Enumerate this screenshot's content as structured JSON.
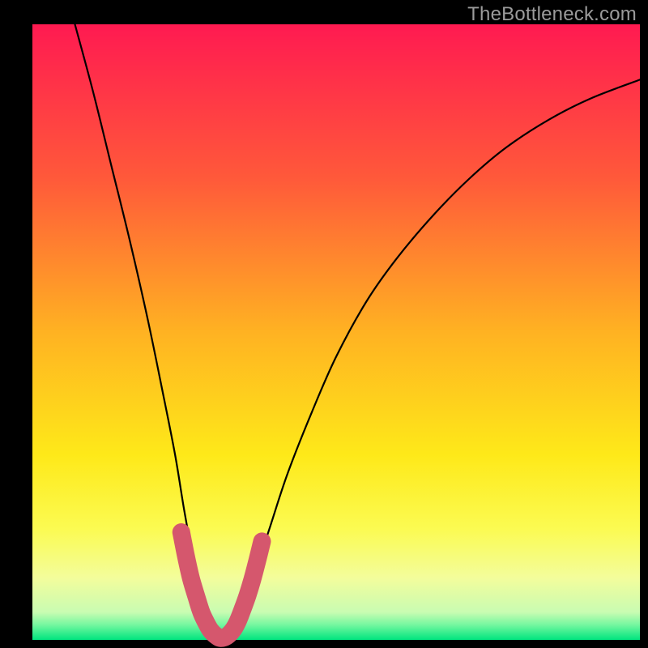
{
  "watermark": "TheBottleneck.com",
  "chart_data": {
    "type": "line",
    "title": "",
    "xlabel": "",
    "ylabel": "",
    "xlim": [
      0,
      100
    ],
    "ylim": [
      0,
      100
    ],
    "axes_visible": false,
    "background_gradient": {
      "stops": [
        {
          "pos": 0.0,
          "color": "#ff1a51"
        },
        {
          "pos": 0.25,
          "color": "#ff593a"
        },
        {
          "pos": 0.5,
          "color": "#ffb222"
        },
        {
          "pos": 0.7,
          "color": "#fee919"
        },
        {
          "pos": 0.82,
          "color": "#fbfb52"
        },
        {
          "pos": 0.9,
          "color": "#f3fd9c"
        },
        {
          "pos": 0.955,
          "color": "#c9fcb2"
        },
        {
          "pos": 0.975,
          "color": "#77f7a0"
        },
        {
          "pos": 1.0,
          "color": "#00e57f"
        }
      ]
    },
    "curve": {
      "x": [
        7,
        10,
        13,
        16,
        19,
        21.5,
        23.5,
        25,
        26.5,
        28,
        29.5,
        31,
        32.5,
        34,
        36,
        39,
        42,
        46,
        50,
        55,
        60,
        66,
        72,
        78,
        85,
        92,
        100
      ],
      "y": [
        100,
        89,
        77,
        65,
        52,
        40,
        30,
        21,
        13,
        6,
        1.5,
        0,
        1.2,
        4,
        9,
        18,
        27,
        37,
        46,
        55,
        62,
        69,
        75,
        80,
        84.5,
        88,
        91
      ],
      "minimum_x": 31
    },
    "highlight": {
      "description": "thick rounded pink overlay near the curve minimum",
      "color": "#d5576d",
      "x": [
        24.5,
        25.3,
        26.1,
        27,
        27.8,
        28.6,
        29.3,
        30.2,
        31,
        32,
        33,
        33.8,
        34.6,
        35.4,
        36.2,
        37,
        37.8
      ],
      "y": [
        17.5,
        13.5,
        10,
        7,
        4.5,
        2.8,
        1.6,
        0.7,
        0.3,
        0.6,
        1.6,
        3,
        5,
        7.2,
        9.8,
        12.8,
        16
      ]
    }
  }
}
